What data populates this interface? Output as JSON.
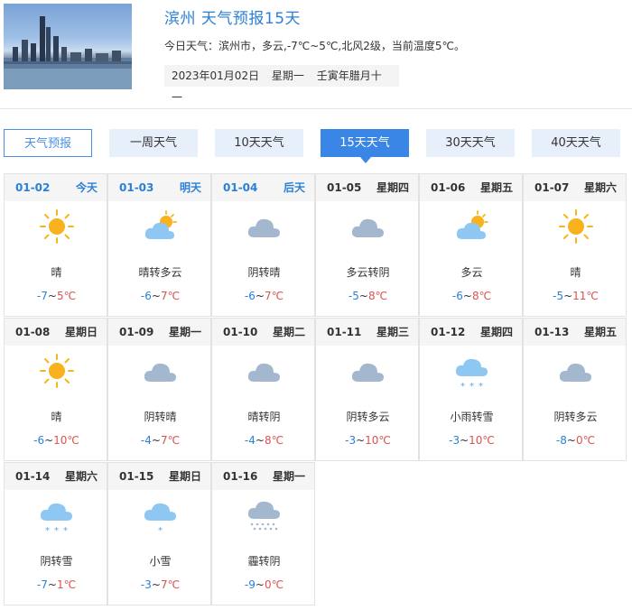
{
  "header": {
    "title": "滨州 天气预报15天",
    "today_desc": "今日天气：滨州市，多云,-7℃~5℃,北风2级，当前温度5℃。",
    "date": "2023年01月02日",
    "weekday": "星期一",
    "lunar": "壬寅年腊月十一"
  },
  "tabs": [
    {
      "label": "天气预报",
      "style": "outline"
    },
    {
      "label": "一周天气",
      "style": "normal"
    },
    {
      "label": "10天天气",
      "style": "normal"
    },
    {
      "label": "15天天气",
      "style": "active"
    },
    {
      "label": "30天天气",
      "style": "normal"
    },
    {
      "label": "40天天气",
      "style": "normal"
    }
  ],
  "days": [
    {
      "date": "01-02",
      "week": "今天",
      "highlight": true,
      "icon": "sun-icon",
      "cond": "晴",
      "lo": "-7",
      "hi": "5℃"
    },
    {
      "date": "01-03",
      "week": "明天",
      "highlight": true,
      "icon": "partly-cloudy-icon",
      "cond": "晴转多云",
      "lo": "-6",
      "hi": "7℃"
    },
    {
      "date": "01-04",
      "week": "后天",
      "highlight": true,
      "icon": "cloud-icon",
      "cond": "阴转晴",
      "lo": "-6",
      "hi": "7℃"
    },
    {
      "date": "01-05",
      "week": "星期四",
      "highlight": false,
      "icon": "cloud-icon",
      "cond": "多云转阴",
      "lo": "-5",
      "hi": "8℃"
    },
    {
      "date": "01-06",
      "week": "星期五",
      "highlight": false,
      "icon": "partly-cloudy-icon",
      "cond": "多云",
      "lo": "-6",
      "hi": "8℃"
    },
    {
      "date": "01-07",
      "week": "星期六",
      "highlight": false,
      "icon": "sun-icon",
      "cond": "晴",
      "lo": "-5",
      "hi": "11℃"
    },
    {
      "date": "01-08",
      "week": "星期日",
      "highlight": false,
      "icon": "sun-icon",
      "cond": "晴",
      "lo": "-6",
      "hi": "10℃"
    },
    {
      "date": "01-09",
      "week": "星期一",
      "highlight": false,
      "icon": "cloud-icon",
      "cond": "阴转晴",
      "lo": "-4",
      "hi": "7℃"
    },
    {
      "date": "01-10",
      "week": "星期二",
      "highlight": false,
      "icon": "cloud-icon",
      "cond": "晴转阴",
      "lo": "-4",
      "hi": "8℃"
    },
    {
      "date": "01-11",
      "week": "星期三",
      "highlight": false,
      "icon": "cloud-icon",
      "cond": "阴转多云",
      "lo": "-3",
      "hi": "10℃"
    },
    {
      "date": "01-12",
      "week": "星期四",
      "highlight": false,
      "icon": "snow-cloud-icon",
      "cond": "小雨转雪",
      "lo": "-3",
      "hi": "10℃"
    },
    {
      "date": "01-13",
      "week": "星期五",
      "highlight": false,
      "icon": "cloud-icon",
      "cond": "阴转多云",
      "lo": "-8",
      "hi": "0℃"
    },
    {
      "date": "01-14",
      "week": "星期六",
      "highlight": false,
      "icon": "snow-cloud-icon",
      "cond": "阴转雪",
      "lo": "-7",
      "hi": "1℃"
    },
    {
      "date": "01-15",
      "week": "星期日",
      "highlight": false,
      "icon": "light-snow-icon",
      "cond": "小雪",
      "lo": "-3",
      "hi": "7℃"
    },
    {
      "date": "01-16",
      "week": "星期一",
      "highlight": false,
      "icon": "haze-icon",
      "cond": "霾转阴",
      "lo": "-9",
      "hi": "0℃"
    }
  ],
  "colors": {
    "accent": "#3a86e6",
    "low": "#2b7fd6",
    "high": "#d9534f"
  }
}
